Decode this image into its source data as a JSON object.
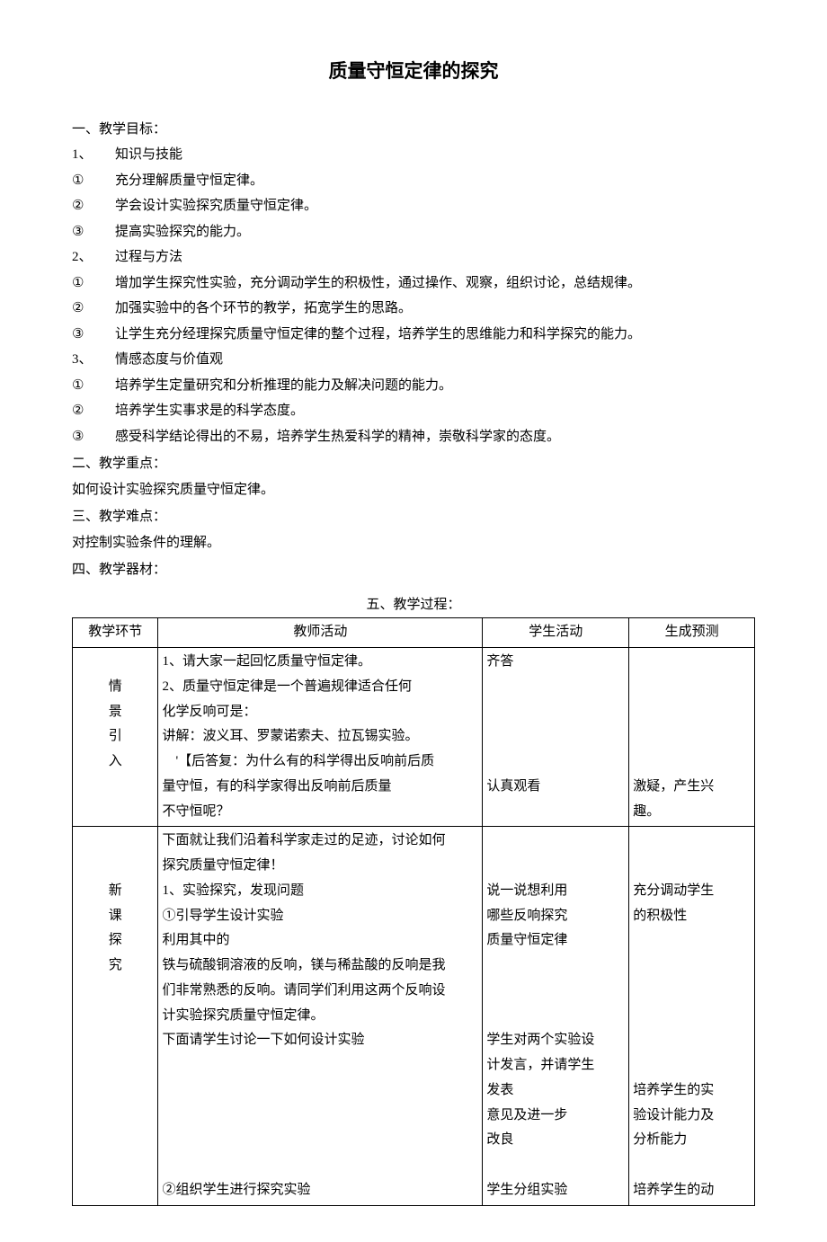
{
  "title": "质量守恒定律的探究",
  "sections": {
    "s1": {
      "heading": "一、教学目标：",
      "g1": {
        "num": "1、",
        "label": "知识与技能",
        "i1_num": "①",
        "i1": "充分理解质量守恒定律。",
        "i2_num": "②",
        "i2": "学会设计实验探究质量守恒定律。",
        "i3_num": "③",
        "i3": "提高实验探究的能力。"
      },
      "g2": {
        "num": "2、",
        "label": "过程与方法",
        "i1_num": "①",
        "i1": "增加学生探究性实验，充分调动学生的积极性，通过操作、观察，组织讨论，总结规律。",
        "i2_num": "②",
        "i2": "加强实验中的各个环节的教学，拓宽学生的思路。",
        "i3_num": "③",
        "i3": "让学生充分经理探究质量守恒定律的整个过程，培养学生的思维能力和科学探究的能力。"
      },
      "g3": {
        "num": "3、",
        "label": "情感态度与价值观",
        "i1_num": "①",
        "i1": "培养学生定量研究和分析推理的能力及解决问题的能力。",
        "i2_num": "②",
        "i2": "培养学生实事求是的科学态度。",
        "i3_num": "③",
        "i3": "感受科学结论得出的不易，培养学生热爱科学的精神，崇敬科学家的态度。"
      }
    },
    "s2": {
      "heading": "二、教学重点：",
      "body": "如何设计实验探究质量守恒定律。"
    },
    "s3": {
      "heading": "三、教学难点：",
      "body": "对控制实验条件的理解。"
    },
    "s4": {
      "heading": "四、教学器材："
    },
    "s5": {
      "heading": "五、教学过程："
    }
  },
  "table": {
    "headers": {
      "h1": "教学环节",
      "h2": "教师活动",
      "h3": "学生活动",
      "h4": "生成预测"
    },
    "row1": {
      "stage_c1": "情",
      "stage_c2": "景",
      "stage_c3": "引",
      "stage_c4": "入",
      "teacher_p1": "1、请大家一起回忆质量守恒定律。",
      "teacher_p2": "2、质量守恒定律是一个普遍规律适合任何",
      "teacher_p3": "化学反响可是：",
      "teacher_p4": "讲解：波义耳、罗蒙诺索夫、拉瓦锡实验。",
      "teacher_p5": "　'【后答复：为什么有的科学得出反响前后质",
      "teacher_p6": "量守恒，有的科学家得出反响前后质量",
      "teacher_p7": "不守恒呢？",
      "student_p1": "齐答",
      "student_p2": "认真观看",
      "pred_p1": "激疑，产生兴",
      "pred_p2": "趣。"
    },
    "row2": {
      "stage_c1": "新",
      "stage_c2": "课",
      "stage_c3": "探",
      "stage_c4": "究",
      "teacher_p0a": "下面就让我们沿着科学家走过的足迹，讨论如何",
      "teacher_p0b": "探究质量守恒定律！",
      "teacher_p1": "1、实验探究，发现问题",
      "teacher_p2": "①引导学生设计实验",
      "teacher_p3": "利用其中的",
      "teacher_p4": "铁与硫酸铜溶液的反响，镁与稀盐酸的反响是我",
      "teacher_p5": "们非常熟悉的反响。请同学们利用这两个反响设",
      "teacher_p6": "计实验探究质量守恒定律。",
      "teacher_p7": "下面请学生讨论一下如何设计实验",
      "teacher_p8": "②组织学生进行探究实验",
      "student_p1": "说一说想利用",
      "student_p2": "哪些反响探究",
      "student_p3": "质量守恒定律",
      "student_p4": "学生对两个实验设",
      "student_p5": "计发言，并请学生",
      "student_p6": "发表",
      "student_p7": "意见及进一步",
      "student_p8": "改良",
      "student_p9": "学生分组实验",
      "pred_p1": "充分调动学生",
      "pred_p2": "的积极性",
      "pred_p3": "培养学生的实",
      "pred_p4": "验设计能力及",
      "pred_p5": "分析能力",
      "pred_p6": "培养学生的动"
    }
  }
}
